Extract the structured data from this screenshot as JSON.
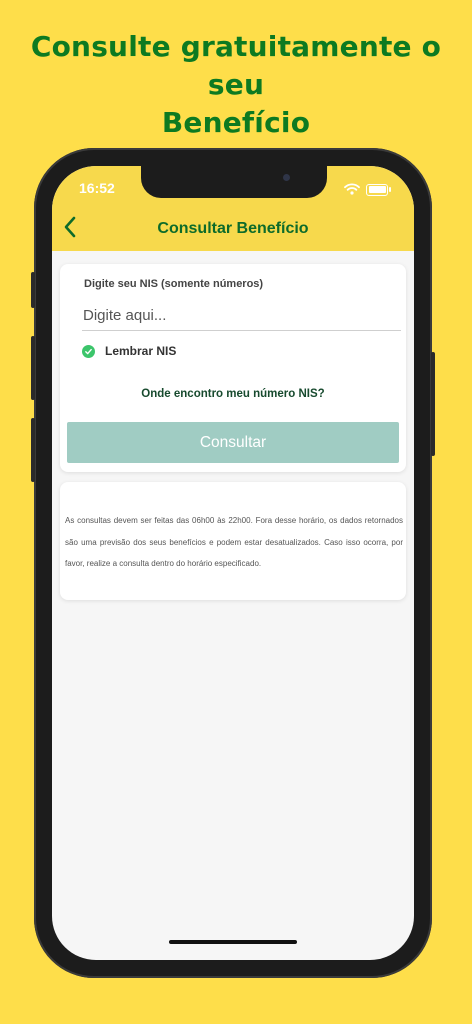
{
  "promo": {
    "title_line1": "Consulte gratuitamente o seu",
    "title_line2": "Benefício"
  },
  "status_bar": {
    "time": "16:52",
    "icons": [
      "wifi-icon",
      "battery-icon"
    ]
  },
  "header": {
    "back_icon": "chevron-left-icon",
    "title": "Consultar Benefício"
  },
  "form": {
    "label": "Digite seu NIS (somente números)",
    "input_value": "",
    "input_placeholder": "Digite aqui...",
    "remember_label": "Lembrar NIS",
    "remember_checked": true,
    "help_link": "Onde encontro meu número NIS?",
    "submit_label": "Consultar"
  },
  "info": {
    "text": "As consultas devem ser feitas das 06h00 às 22h00. Fora desse horário, os dados retornados são uma previsão dos seus benefícios e podem estar desatualizados. Caso isso ocorra, por favor, realize a consulta dentro do horário especificado."
  },
  "colors": {
    "background": "#FEDE4A",
    "promo_text": "#0D7A21",
    "header_bg": "#F7D94C",
    "header_title": "#0D6B2A",
    "button_bg": "#A0CCC3",
    "check": "#3CC56B"
  }
}
